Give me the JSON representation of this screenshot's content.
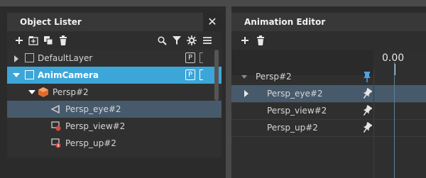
{
  "colors": {
    "selected_row": "#3da6d9",
    "highlight_row": "#465a6b",
    "camera_icon": "#e06a2b",
    "pin_active": "#4aa3e8"
  },
  "object_lister": {
    "title": "Object Lister",
    "close_icon": "close-icon",
    "toolbar_icons": [
      "add-icon",
      "add-node-icon",
      "duplicate-icon",
      "delete-icon",
      "search-icon",
      "filter-icon",
      "settings-icon",
      "menu-icon"
    ],
    "rows": [
      {
        "label": "DefaultLayer",
        "badge": "P"
      },
      {
        "label": "AnimCamera",
        "badge": "P"
      },
      {
        "label": "Persp#2"
      },
      {
        "label": "Persp_eye#2"
      },
      {
        "label": "Persp_view#2"
      },
      {
        "label": "Persp_up#2"
      }
    ]
  },
  "animation_editor": {
    "title": "Animation Editor",
    "toolbar_icons": [
      "add-icon",
      "delete-icon"
    ],
    "timecode": "0.00",
    "tracks": [
      {
        "label": "Persp#2"
      },
      {
        "label": "Persp_eye#2"
      },
      {
        "label": "Persp_view#2"
      },
      {
        "label": "Persp_up#2"
      }
    ]
  }
}
